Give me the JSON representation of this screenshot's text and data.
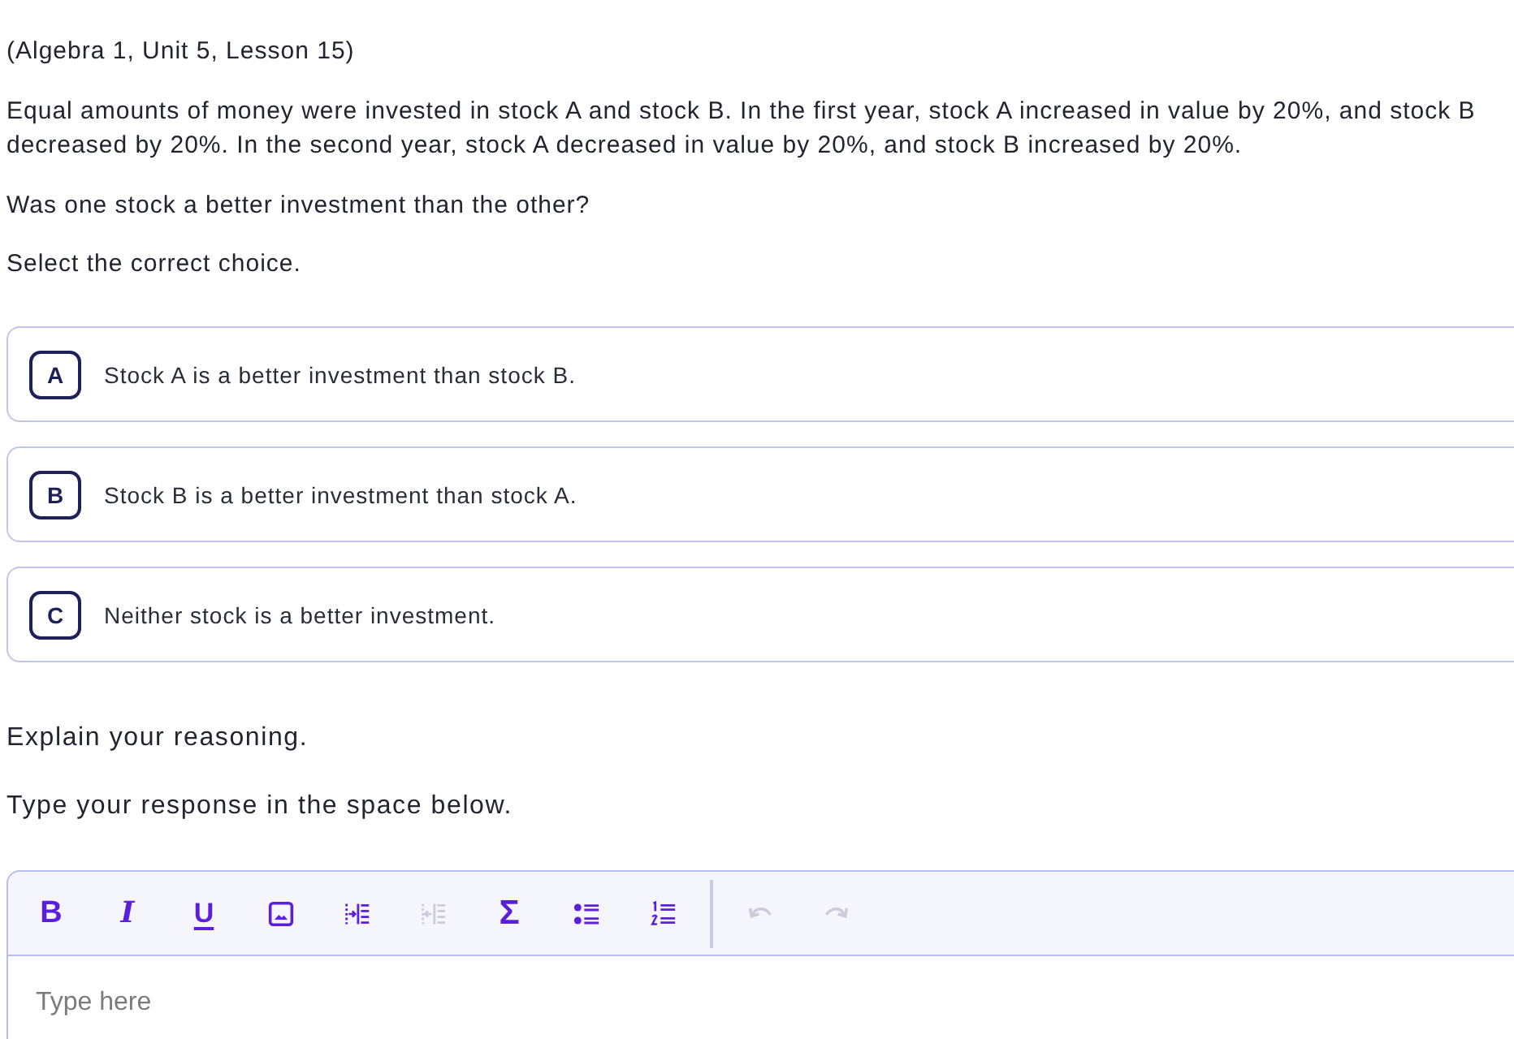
{
  "lesson_label": "(Algebra 1, Unit 5, Lesson 15)",
  "question": {
    "paragraphs": [
      "Equal amounts of money were invested in stock A and stock B. In the first year, stock A increased in value by 20%, and stock B decreased by 20%. In the second year, stock A decreased in value by 20%, and stock B increased by 20%.",
      "Was one stock a better investment than the other?"
    ]
  },
  "instruction": "Select the correct choice.",
  "choices": [
    {
      "letter": "A",
      "text": "Stock A is a better investment than stock B.",
      "selected": false
    },
    {
      "letter": "B",
      "text": "Stock B is a better investment than stock A.",
      "selected": false
    },
    {
      "letter": "C",
      "text": "Neither stock is a better investment.",
      "selected": false
    }
  ],
  "response": {
    "prompt": "Explain your reasoning.",
    "instruction": "Type your response in the space below.",
    "editor": {
      "toolbar": [
        {
          "buttons": [
            {
              "kind": "bold",
              "label": "B",
              "disabled": false
            },
            {
              "kind": "italic",
              "label": "I",
              "disabled": false
            },
            {
              "kind": "underline",
              "label": "U",
              "disabled": false
            },
            {
              "kind": "image",
              "disabled": false
            },
            {
              "kind": "indent",
              "disabled": false
            },
            {
              "kind": "outdent",
              "disabled": true
            },
            {
              "kind": "equation",
              "label": "Σ",
              "disabled": false
            },
            {
              "kind": "bullet_list",
              "disabled": false
            },
            {
              "kind": "numbered_list",
              "disabled": false
            }
          ]
        },
        {
          "buttons": [
            {
              "kind": "undo",
              "disabled": true
            },
            {
              "kind": "redo",
              "disabled": true
            }
          ]
        }
      ],
      "placeholder": "Type here"
    }
  }
}
